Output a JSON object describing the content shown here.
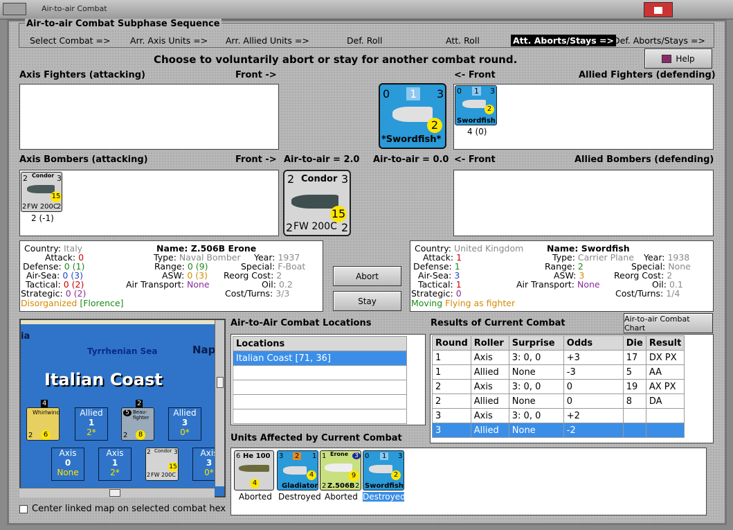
{
  "window": {
    "title": "Air-to-air Combat"
  },
  "subphase": {
    "title": "Air-to-air Combat Subphase Sequence",
    "steps": [
      "Select Combat =>",
      "Arr. Axis Units =>",
      "Arr. Allied Units =>",
      "Def. Roll",
      "Att. Roll",
      "Att. Aborts/Stays =>",
      "Def. Aborts/Stays =>"
    ],
    "active_index": 5
  },
  "prompt": "Choose to voluntarily abort or stay for another combat round.",
  "help_label": "Help",
  "sections": {
    "axis_fighters": "Axis Fighters (attacking)",
    "front_right": "Front ->",
    "front_left": "<- Front",
    "allied_fighters": "Allied Fighters (defending)",
    "axis_bombers": "Axis Bombers (attacking)",
    "air_axis": "Air-to-air = 2.0",
    "air_allied": "Air-to-air = 0.0",
    "allied_bombers": "Allied Bombers (defending)"
  },
  "big_allied_counter": {
    "left": "0",
    "mid": "1",
    "right": "3",
    "circle": "2",
    "name": "*Swordfish*"
  },
  "small_allied_counter": {
    "left": "0",
    "mid": "1",
    "right": "3",
    "circle": "2",
    "name": "Swordfish",
    "caption": "4 (0)"
  },
  "small_axis_bomber": {
    "left": "2",
    "top": "Condor",
    "right": "3",
    "circle": "15",
    "name": "FW 200C",
    "bl": "2",
    "br": "2",
    "caption": "2 (-1)"
  },
  "big_axis_bomber": {
    "left": "2",
    "top": "Condor",
    "right": "3",
    "circle": "15",
    "name": "FW 200C",
    "bl": "2",
    "br": "2"
  },
  "axis_info": {
    "country_k": "Country:",
    "country_v": "Italy",
    "attack_k": "Attack:",
    "attack_v": "0",
    "defense_k": "Defense:",
    "defense_v": "0",
    "defense_p": "(1)",
    "airsea_k": "Air-Sea:",
    "airsea_v": "0",
    "airsea_p": "(3)",
    "tactical_k": "Tactical:",
    "tactical_v": "0",
    "tactical_p": "(2)",
    "strategic_k": "Strategic:",
    "strategic_v": "0",
    "strategic_p": "(2)",
    "status": "Disorganized",
    "status_loc": "[Florence]",
    "name_k": "Name:",
    "name_v": "Z.506B Erone",
    "type_k": "Type:",
    "type_v": "Naval Bomber",
    "year_k": "Year:",
    "year_v": "1937",
    "range_k": "Range:",
    "range_v": "0",
    "range_p": "(9)",
    "special_k": "Special:",
    "special_v": "F-Boat",
    "asw_k": "ASW:",
    "asw_v": "0",
    "asw_p": "(3)",
    "reorg_k": "Reorg Cost:",
    "reorg_v": "2",
    "transport_k": "Air Transport:",
    "transport_v": "None",
    "oil_k": "Oil:",
    "oil_v": "0.2",
    "cost_k": "Cost/Turns:",
    "cost_v": "3/3"
  },
  "allied_info": {
    "country_k": "Country:",
    "country_v": "United Kingdom",
    "attack_k": "Attack:",
    "attack_v": "1",
    "defense_k": "Defense:",
    "defense_v": "1",
    "airsea_k": "Air-Sea:",
    "airsea_v": "3",
    "tactical_k": "Tactical:",
    "tactical_v": "1",
    "strategic_k": "Strategic:",
    "strategic_v": "0",
    "status": "Moving",
    "status2": "Flying as fighter",
    "name_k": "Name:",
    "name_v": "Swordfish",
    "type_k": "Type:",
    "type_v": "Carrier Plane",
    "year_k": "Year:",
    "year_v": "1938",
    "range_k": "Range:",
    "range_v": "2",
    "special_k": "Special:",
    "special_v": "None",
    "asw_k": "ASW:",
    "asw_v": "3",
    "reorg_k": "Reorg Cost:",
    "reorg_v": "2",
    "transport_k": "Air Transport:",
    "transport_v": "None",
    "oil_k": "Oil:",
    "oil_v": "0.1",
    "cost_k": "Cost/Turns:",
    "cost_v": "1/4"
  },
  "buttons": {
    "abort": "Abort",
    "stay": "Stay",
    "chart": "Air-to-air Combat Chart"
  },
  "map": {
    "sea": "Tyrrhenian Sea",
    "region": "Italian Coast",
    "frag_left": "ia",
    "frag_right": "Nap",
    "hexes": [
      {
        "side": "Allied",
        "num": "1",
        "sub": "2*"
      },
      {
        "side": "Allied",
        "num": "3",
        "sub": "0*"
      },
      {
        "side": "Axis",
        "num": "0",
        "sub": "None"
      },
      {
        "side": "Axis",
        "num": "1",
        "sub": "2*"
      },
      {
        "side": "Axis",
        "num": "3",
        "sub": "0*"
      }
    ],
    "counters": [
      {
        "top": "4",
        "name": "Whirlwind",
        "bl": "2",
        "circle": "6"
      },
      {
        "top": "2",
        "name": "Beau-fighter",
        "bl": "2",
        "circle": "8",
        "tl": "5"
      },
      {
        "name": "Condor",
        "circle": "15",
        "bl": "2",
        "tl": "2",
        "tr": "3",
        "sub": "FW 200C"
      }
    ]
  },
  "locations": {
    "title": "Air-to-Air Combat Locations",
    "header": "Locations",
    "rows": [
      "Italian Coast [71, 36]",
      "",
      "",
      "",
      ""
    ]
  },
  "results": {
    "title": "Results of Current Combat",
    "headers": [
      "Round",
      "Roller",
      "Surprise",
      "Odds",
      "Die",
      "Result"
    ],
    "rows": [
      [
        "1",
        "Axis",
        "3: 0, 0",
        "+3",
        "17",
        "DX PX"
      ],
      [
        "1",
        "Allied",
        "None",
        "-3",
        "5",
        "AA"
      ],
      [
        "2",
        "Axis",
        "3: 0, 0",
        "0",
        "19",
        "AX PX"
      ],
      [
        "2",
        "Allied",
        "None",
        "0",
        "8",
        "DA"
      ],
      [
        "3",
        "Axis",
        "3: 0, 0",
        "+2",
        "",
        ""
      ],
      [
        "3",
        "Allied",
        "None",
        "-2",
        "",
        ""
      ]
    ]
  },
  "affected": {
    "title": "Units Affected by Current Combat",
    "units": [
      {
        "name": "He 100",
        "tl": "6",
        "circle": "4",
        "caption": "Aborted"
      },
      {
        "name": "Gladiator",
        "tl": "3",
        "mid": "2",
        "tr": "1",
        "circle": "4",
        "caption": "Destroyed"
      },
      {
        "name": "Z.506B",
        "top": "Erone",
        "tl": "1",
        "tr": "3",
        "circle": "9",
        "bl": "2",
        "br": "2",
        "caption": "Aborted"
      },
      {
        "name": "Swordfish",
        "tl": "0",
        "mid": "1",
        "tr": "3",
        "circle": "2",
        "caption": "Destroyed"
      }
    ]
  },
  "center_checkbox": "Center linked map on selected combat hex",
  "colors": {
    "selection": "#3a8ee8",
    "map_sea": "#2f74c8",
    "yellow": "#ffe600"
  }
}
